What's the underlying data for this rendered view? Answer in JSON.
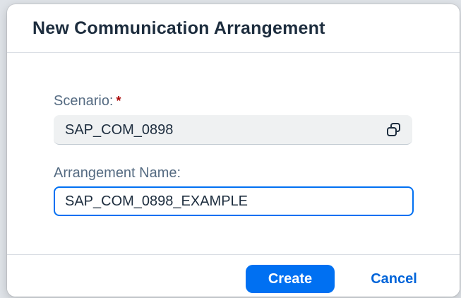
{
  "dialog": {
    "title": "New Communication Arrangement"
  },
  "fields": {
    "scenario": {
      "label": "Scenario:",
      "required_marker": "*",
      "value": "SAP_COM_0898",
      "icon": "value-help-copy-icon"
    },
    "arrangement_name": {
      "label": "Arrangement Name:",
      "value": "SAP_COM_0898_EXAMPLE"
    }
  },
  "footer": {
    "create_label": "Create",
    "cancel_label": "Cancel"
  },
  "colors": {
    "accent": "#0070f2",
    "title_text": "#1d2d3e",
    "label_text": "#556b82",
    "required": "#aa0808",
    "readonly_bg": "#eff1f2"
  }
}
